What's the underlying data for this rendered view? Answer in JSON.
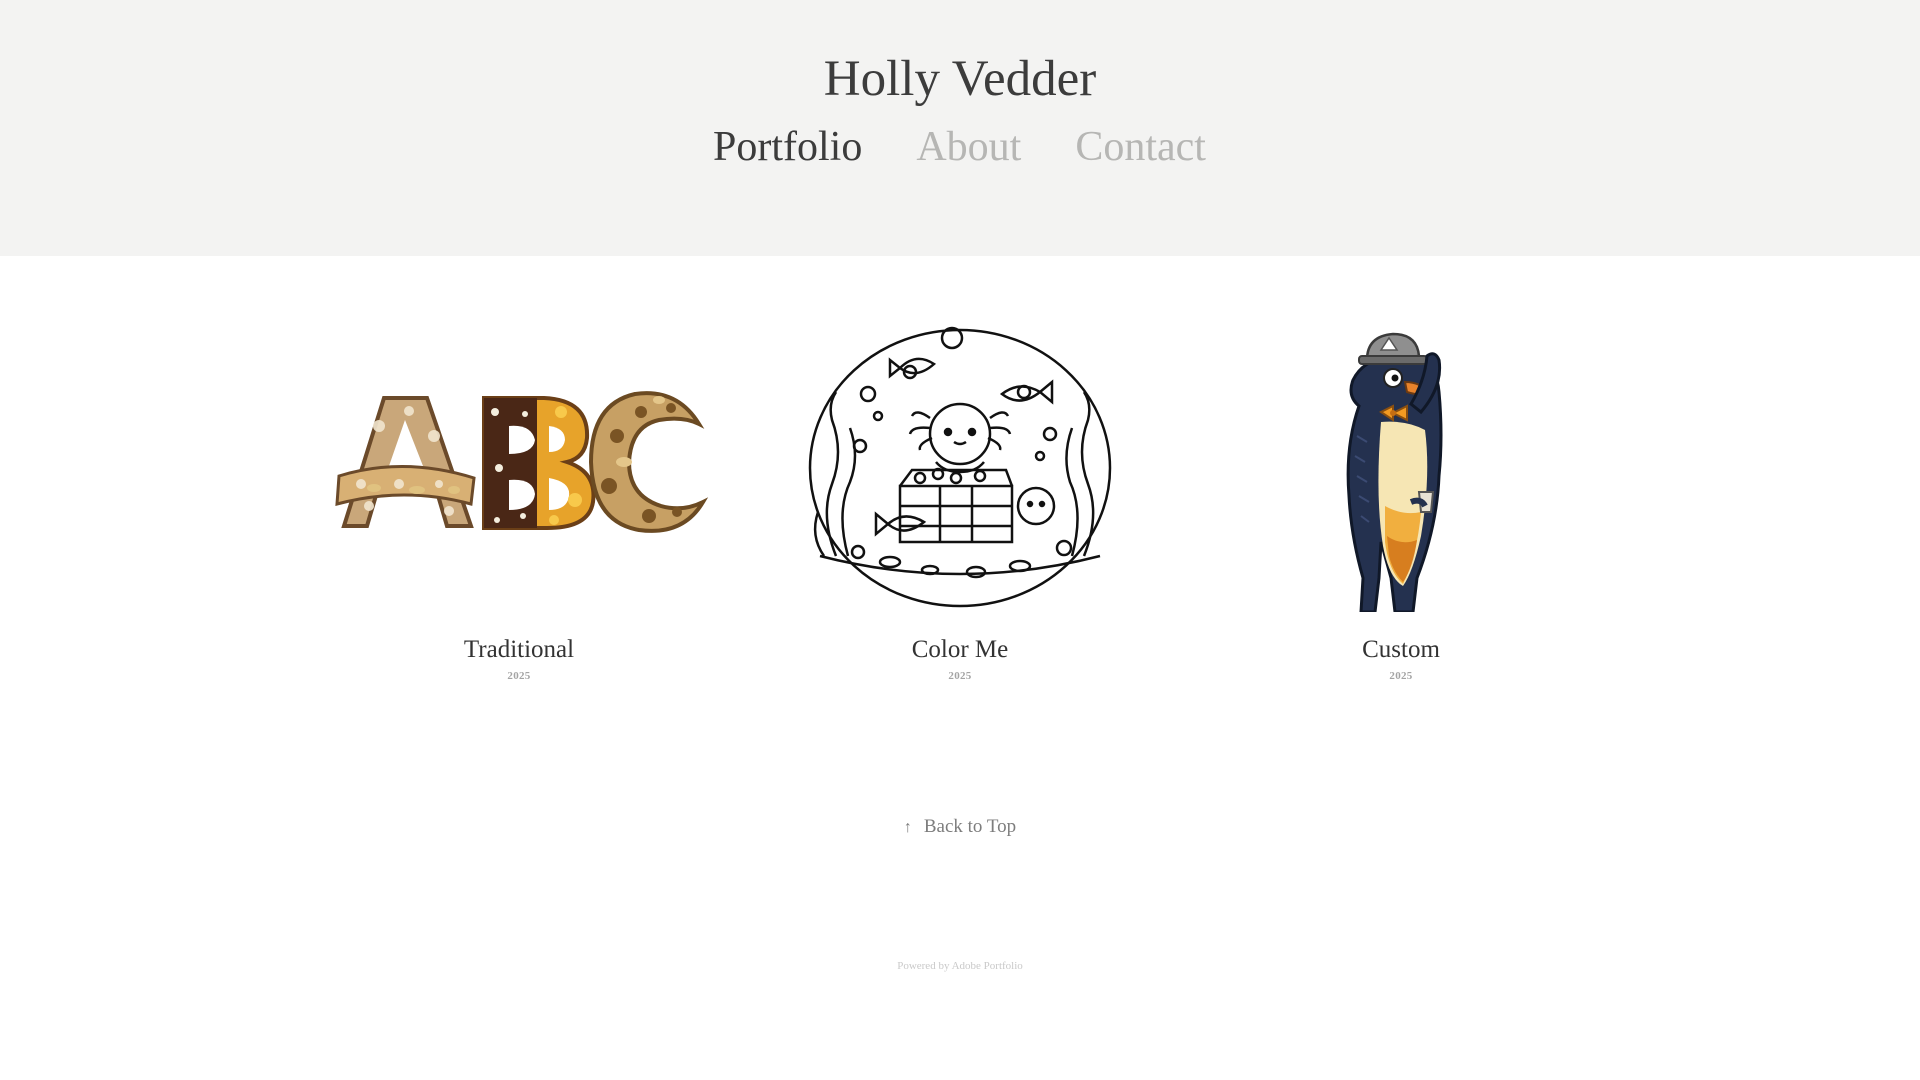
{
  "site": {
    "title": "Holly Vedder"
  },
  "nav": {
    "items": [
      "Portfolio",
      "About",
      "Contact"
    ],
    "active": "Portfolio"
  },
  "projects": [
    {
      "title": "Traditional",
      "year": "2025",
      "thumbnail_icon": "abc-food-letters-illustration"
    },
    {
      "title": "Color Me",
      "year": "2025",
      "thumbnail_icon": "axolotl-treasure-coloring-page"
    },
    {
      "title": "Custom",
      "year": "2025",
      "thumbnail_icon": "penguin-illustration"
    }
  ],
  "back_to_top": {
    "arrow": "↑",
    "label": "Back to Top"
  },
  "footer": {
    "text": "Powered by Adobe Portfolio"
  },
  "colors": {
    "header_bg": "#f3f3f2",
    "text_dark": "#3c3c3c",
    "text_muted": "#b6b6b4",
    "year": "#a4a4a4"
  }
}
